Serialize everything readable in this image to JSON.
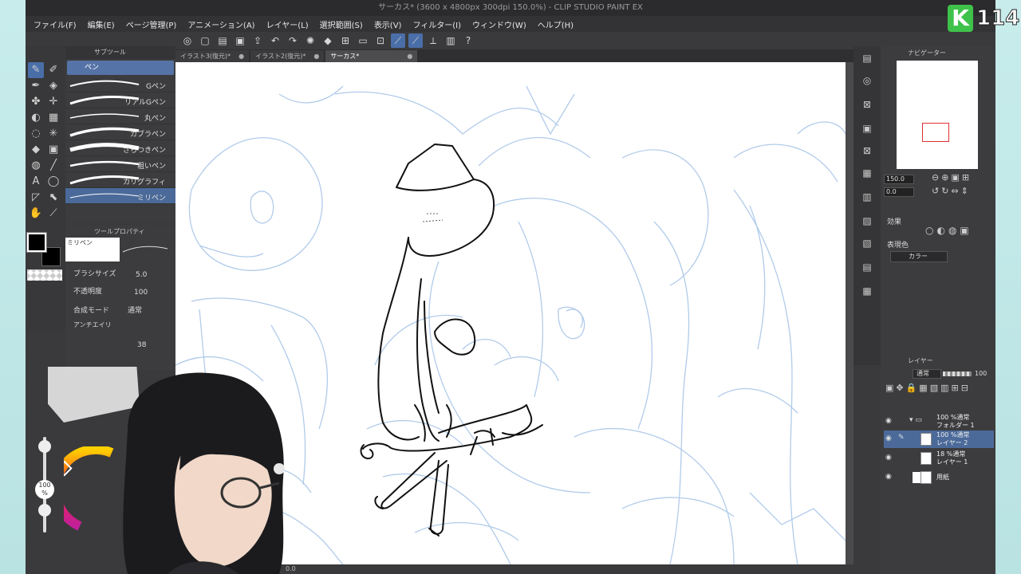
{
  "app": {
    "title": "サーカス* (3600 x 4800px 300dpi 150.0%) - CLIP STUDIO PAINT EX"
  },
  "menu": [
    "ファイル(F)",
    "編集(E)",
    "ページ管理(P)",
    "アニメーション(A)",
    "レイヤー(L)",
    "選択範囲(S)",
    "表示(V)",
    "フィルター(I)",
    "ウィンドウ(W)",
    "ヘルプ(H)"
  ],
  "tabs": [
    {
      "label": "イラスト3(復元)*"
    },
    {
      "label": "イラスト2(復元)*"
    },
    {
      "label": "サーカス*"
    }
  ],
  "tab_close": "●",
  "subtool": {
    "title": "サブツール",
    "group": "ペン",
    "items": [
      "Gペン",
      "リアルGペン",
      "丸ペン",
      "カブラペン",
      "ざらつきペン",
      "粗いペン",
      "カリグラフィ",
      "ミリペン"
    ]
  },
  "toolprop": {
    "title": "ツールプロパティ",
    "tool_name": "ミリペン",
    "brush_size_label": "ブラシサイズ",
    "brush_size_value": "5.0",
    "opacity_label": "不透明度",
    "opacity_value": "100",
    "blend_label": "合成モード",
    "blend_value": "通常",
    "aa_label": "アンチエイリ",
    "extra_value": "38"
  },
  "color": {
    "main": "#000000",
    "sub": "#000000",
    "percent": "100 %"
  },
  "navigator": {
    "title": "ナビゲーター",
    "zoom": "150.0",
    "rotate": "0.0"
  },
  "effect": {
    "title": "効果",
    "expr_label": "表現色",
    "expr_value": "カラー"
  },
  "layers": {
    "title": "レイヤー",
    "blend": "通常",
    "opacity": "100",
    "items": [
      {
        "line1": "100 %通常",
        "line2": "フォルダー 1"
      },
      {
        "line1": "100 %通常",
        "line2": "レイヤー 2"
      },
      {
        "line1": "18 %通常",
        "line2": "レイヤー 1"
      },
      {
        "line1": "",
        "line2": "用紙"
      }
    ]
  },
  "bottom": {
    "zoom": "0.0"
  },
  "overlay": {
    "logo_letter": "K",
    "logo_number": "114"
  },
  "colors": {
    "ui_dark": "#3a3a3c",
    "accent": "#4a6ea8",
    "sketch_blue": "#a9c6e8",
    "logo_green": "#3ec24a"
  }
}
